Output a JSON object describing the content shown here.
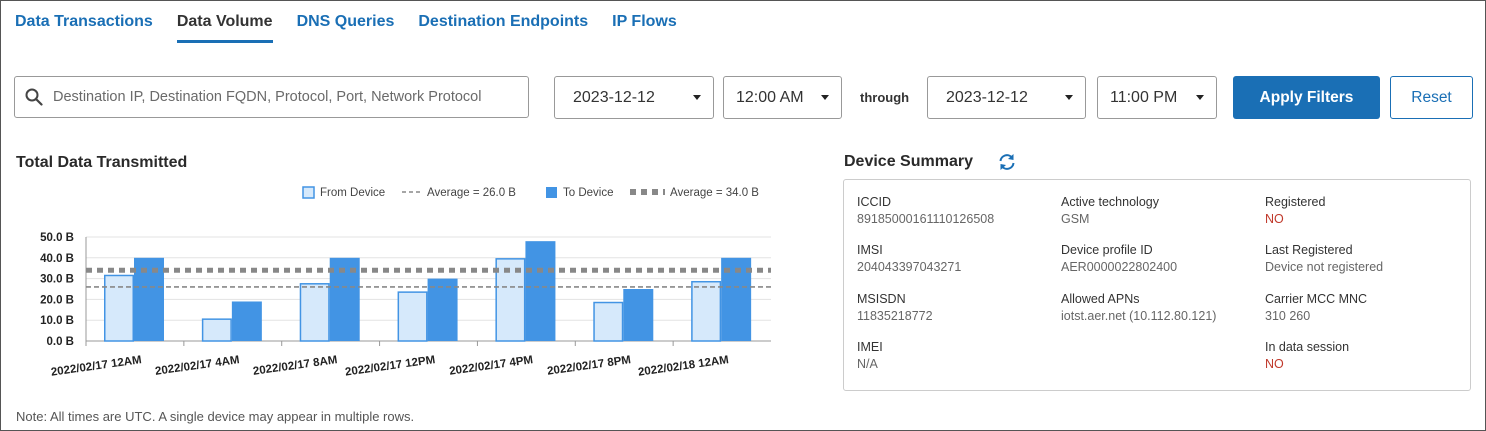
{
  "tabs": [
    {
      "label": "Data Transactions",
      "active": false
    },
    {
      "label": "Data Volume",
      "active": true
    },
    {
      "label": "DNS Queries",
      "active": false
    },
    {
      "label": "Destination Endpoints",
      "active": false
    },
    {
      "label": "IP Flows",
      "active": false
    }
  ],
  "filters": {
    "search_placeholder": "Destination IP, Destination FQDN, Protocol, Port, Network Protocol",
    "start_date": "2023-12-12",
    "start_time": "12:00 AM",
    "through_label": "through",
    "end_date": "2023-12-12",
    "end_time": "11:00 PM",
    "apply_label": "Apply Filters",
    "reset_label": "Reset"
  },
  "chart_title": "Total Data Transmitted",
  "chart_data": {
    "type": "bar",
    "categories": [
      "2022/02/17 12AM",
      "2022/02/17 4AM",
      "2022/02/17 8AM",
      "2022/02/17 12PM",
      "2022/02/17 4PM",
      "2022/02/17 8PM",
      "2022/02/18 12AM"
    ],
    "series": [
      {
        "name": "From Device",
        "values": [
          31.5,
          10.5,
          27.5,
          23.5,
          39.5,
          18.5,
          28.5
        ],
        "color": "#d6e9fb",
        "stroke": "#4294e4"
      },
      {
        "name": "To Device",
        "values": [
          40,
          19,
          40,
          30,
          48,
          25,
          40
        ],
        "color": "#4294e4"
      }
    ],
    "averages": [
      {
        "label": "Average = 26.0 B",
        "value": 26.0,
        "style": "dashed-thin",
        "color": "#888888"
      },
      {
        "label": "Average = 34.0 B",
        "value": 34.0,
        "style": "dashed-thick",
        "color": "#888888"
      }
    ],
    "yticks": [
      "0.0 B",
      "10.0 B",
      "20.0 B",
      "30.0 B",
      "40.0 B",
      "50.0 B"
    ],
    "ylim": [
      0,
      50
    ],
    "grid": true,
    "legend": "top-right"
  },
  "device_summary": {
    "title": "Device Summary",
    "refresh_icon": "refresh-icon",
    "fields": [
      {
        "label": "ICCID",
        "value": "89185000161110126508",
        "red": false
      },
      {
        "label": "Active technology",
        "value": "GSM",
        "red": false
      },
      {
        "label": "Registered",
        "value": "NO",
        "red": true
      },
      {
        "label": "IMSI",
        "value": "204043397043271",
        "red": false
      },
      {
        "label": "Device profile ID",
        "value": "AER0000022802400",
        "red": false
      },
      {
        "label": "Last Registered",
        "value": "Device not registered",
        "red": false
      },
      {
        "label": "MSISDN",
        "value": "11835218772",
        "red": false
      },
      {
        "label": "Allowed APNs",
        "value": "iotst.aer.net (10.112.80.121)",
        "red": false
      },
      {
        "label": "Carrier MCC MNC",
        "value": "310 260",
        "red": false
      },
      {
        "label": "IMEI",
        "value": "N/A",
        "red": false
      },
      {
        "label": "In data session",
        "value": "NO",
        "red": true
      }
    ]
  },
  "note": "Note: All times are UTC. A single device may appear in multiple rows.",
  "colors": {
    "accent": "#1a6fb5",
    "bar_to": "#4294e4",
    "bar_from": "#d6e9fb",
    "alert": "#c0392b"
  }
}
